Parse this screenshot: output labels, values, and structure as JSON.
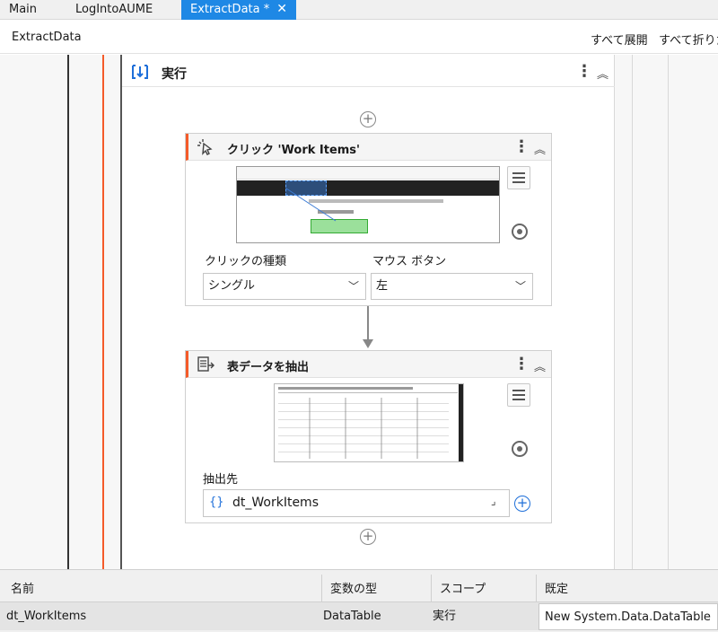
{
  "tabs": [
    {
      "label": "Main"
    },
    {
      "label": "LogIntoAUME"
    },
    {
      "label": "ExtractData *"
    }
  ],
  "breadcrumb": "ExtractData",
  "toolbar": {
    "expand_all": "すべて展開",
    "collapse_all": "すべて折りたた"
  },
  "sequence": {
    "title": "実行"
  },
  "click_activity": {
    "title": "クリック 'Work Items'",
    "click_type_label": "クリックの種類",
    "click_type_value": "シングル",
    "mouse_button_label": "マウス ボタン",
    "mouse_button_value": "左"
  },
  "extract_activity": {
    "title": "表データを抽出",
    "output_label": "抽出先",
    "output_value": "dt_WorkItems",
    "output_prefix": "{}"
  },
  "variables": {
    "headers": [
      "名前",
      "変数の型",
      "スコープ",
      "既定"
    ],
    "rows": [
      {
        "name": "dt_WorkItems",
        "type": "DataTable",
        "scope": "実行",
        "default": "New System.Data.DataTable"
      }
    ]
  },
  "colors": {
    "accent": "#1e88e5",
    "activity_marker": "#f45b2a"
  }
}
